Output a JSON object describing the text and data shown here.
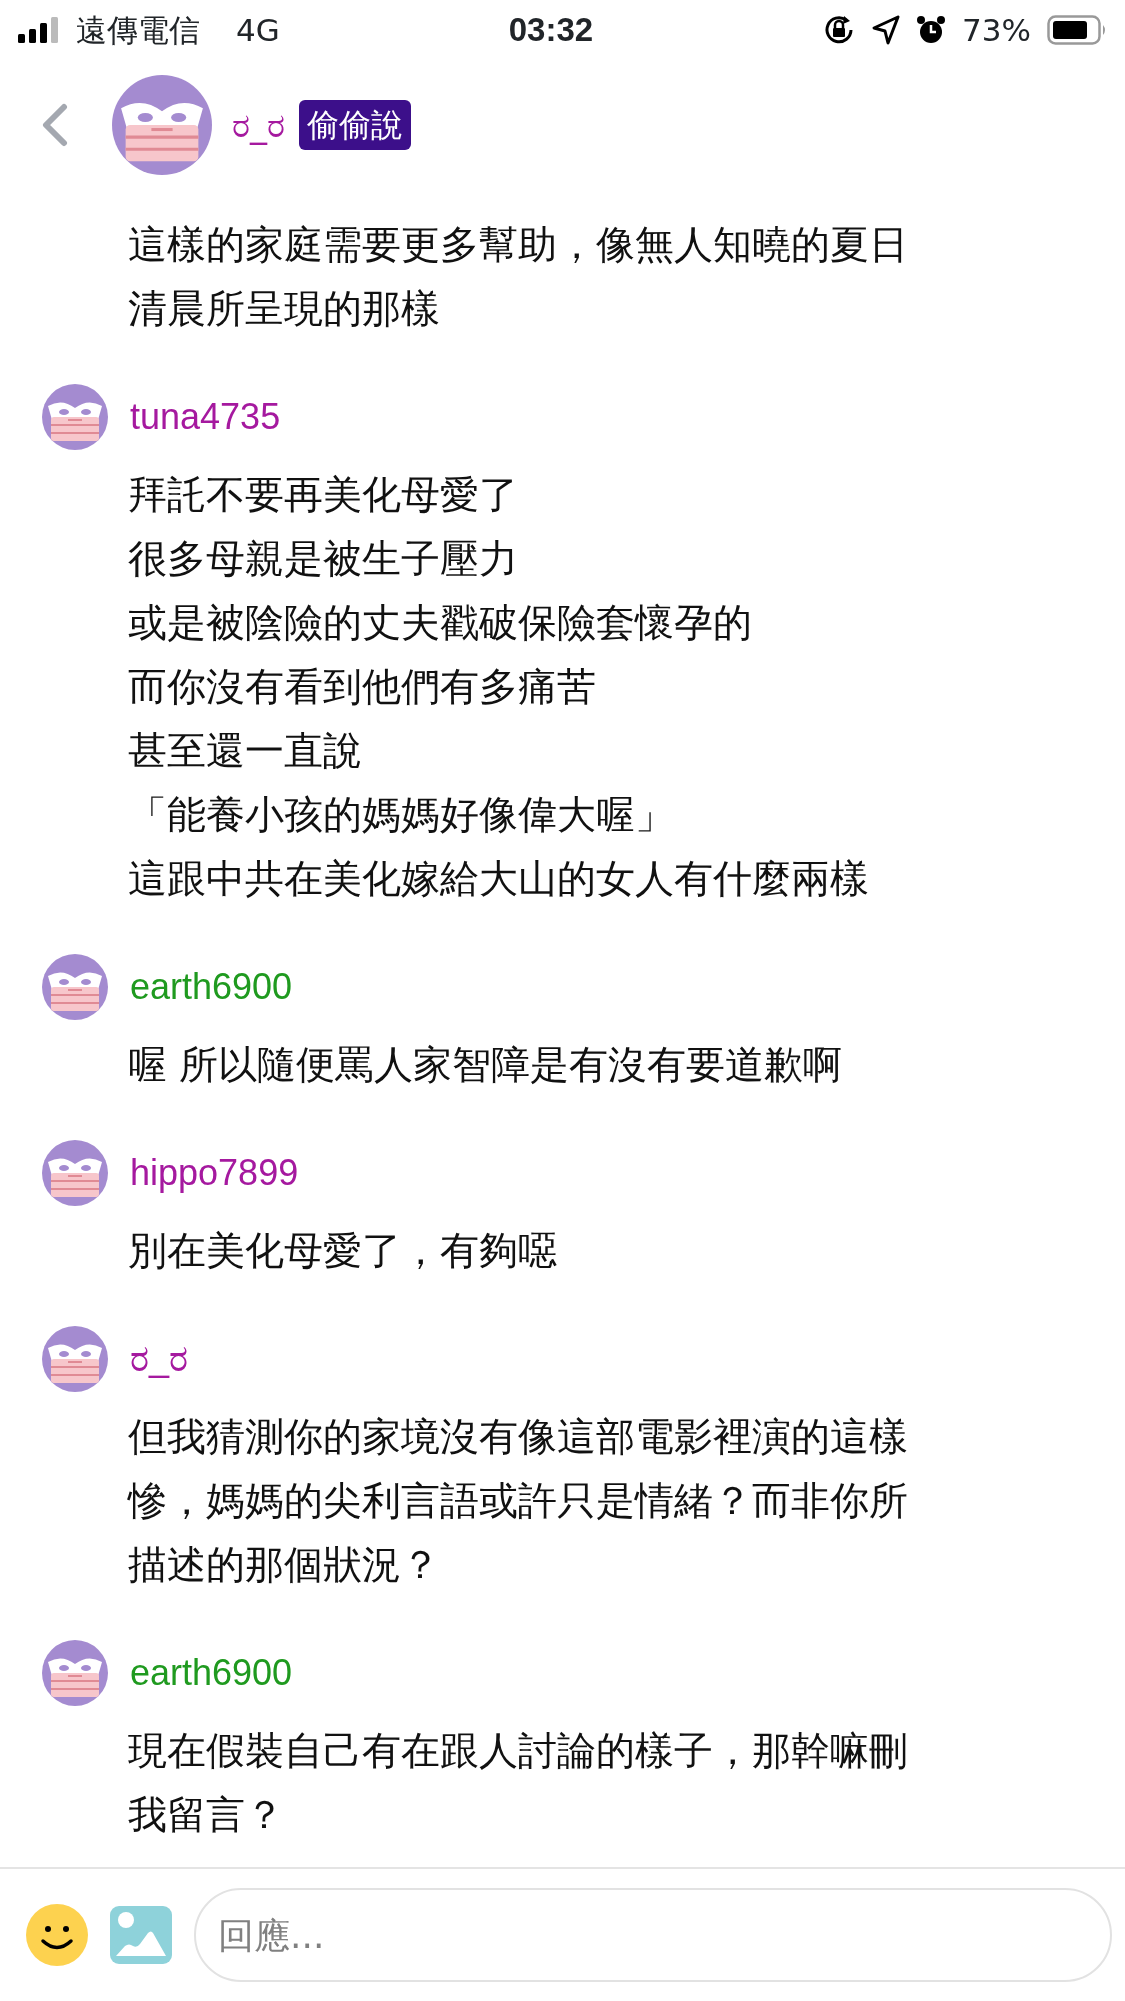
{
  "status_bar": {
    "carrier": "遠傳電信",
    "network": "4G",
    "time": "03:32",
    "battery": "73%"
  },
  "header": {
    "name": "ರ_ರ",
    "badge": "偷偷說"
  },
  "first_comment_lines": [
    "這樣的家庭需要更多幫助，像無人知曉的夏日",
    "清晨所呈現的那樣"
  ],
  "comments": [
    {
      "user": "tuna4735",
      "color": "#a5199f",
      "lines": [
        "拜託不要再美化母愛了",
        "很多母親是被生子壓力",
        "或是被陰險的丈夫戳破保險套懷孕的",
        "而你沒有看到他們有多痛苦",
        "甚至還一直說",
        "「能養小孩的媽媽好像偉大喔」",
        "這跟中共在美化嫁給大山的女人有什麼兩樣"
      ]
    },
    {
      "user": "earth6900",
      "color": "#1f9a1f",
      "lines": [
        "喔 所以隨便罵人家智障是有沒有要道歉啊"
      ]
    },
    {
      "user": "hippo7899",
      "color": "#a5199f",
      "lines": [
        "別在美化母愛了，有夠噁"
      ]
    },
    {
      "user": "ರ_ರ",
      "color": "#a5199f",
      "lines": [
        "但我猜測你的家境沒有像這部電影裡演的這樣",
        "慘，媽媽的尖利言語或許只是情緒？而非你所",
        "描述的那個狀況？"
      ]
    },
    {
      "user": "earth6900",
      "color": "#1f9a1f",
      "lines": [
        "現在假裝自己有在跟人討論的樣子，那幹嘛刪",
        "我留言？"
      ]
    }
  ],
  "reply": {
    "placeholder": "回應..."
  }
}
